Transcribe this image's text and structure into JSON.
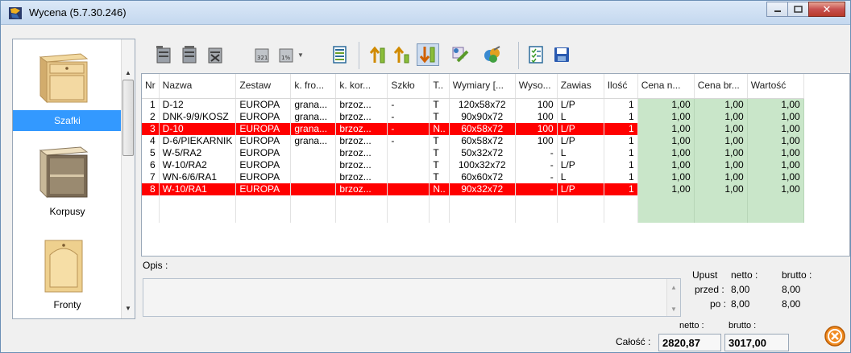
{
  "window": {
    "title": "Wycena (5.7.30.246)"
  },
  "sidebar": {
    "categories": [
      {
        "label": "Szafki",
        "icon": "cabinet-icon",
        "selected": true
      },
      {
        "label": "Korpusy",
        "icon": "carcass-icon",
        "selected": false
      },
      {
        "label": "Fronty",
        "icon": "front-door-icon",
        "selected": false
      }
    ]
  },
  "table": {
    "columns": [
      "Nr",
      "Nazwa",
      "Zestaw",
      "k. fro...",
      "k. kor...",
      "Szkło",
      "T..",
      "Wymiary [...",
      "Wyso...",
      "Zawias",
      "Ilość",
      "Cena n...",
      "Cena br...",
      "Wartość"
    ],
    "rows": [
      {
        "nr": "1",
        "nazwa": "D-12",
        "zestaw": "EUROPA",
        "kfro": "grana...",
        "kkor": "brzoz...",
        "szklo": "-",
        "t": "T",
        "wym": "120x58x72",
        "wys": "100",
        "zaw": "L/P",
        "ilosc": "1",
        "cn": "1,00",
        "cb": "1,00",
        "wart": "1,00",
        "highlight": false
      },
      {
        "nr": "2",
        "nazwa": "DNK-9/9/KOSZ",
        "zestaw": "EUROPA",
        "kfro": "grana...",
        "kkor": "brzoz...",
        "szklo": "-",
        "t": "T",
        "wym": "90x90x72",
        "wys": "100",
        "zaw": "L",
        "ilosc": "1",
        "cn": "1,00",
        "cb": "1,00",
        "wart": "1,00",
        "highlight": false
      },
      {
        "nr": "3",
        "nazwa": "D-10",
        "zestaw": "EUROPA",
        "kfro": "grana...",
        "kkor": "brzoz...",
        "szklo": "-",
        "t": "N..",
        "wym": "60x58x72",
        "wys": "100",
        "zaw": "L/P",
        "ilosc": "1",
        "cn": "1,00",
        "cb": "1,00",
        "wart": "1,00",
        "highlight": true
      },
      {
        "nr": "4",
        "nazwa": "D-6/PIEKARNIK",
        "zestaw": "EUROPA",
        "kfro": "grana...",
        "kkor": "brzoz...",
        "szklo": "-",
        "t": "T",
        "wym": "60x58x72",
        "wys": "100",
        "zaw": "L/P",
        "ilosc": "1",
        "cn": "1,00",
        "cb": "1,00",
        "wart": "1,00",
        "highlight": false
      },
      {
        "nr": "5",
        "nazwa": "W-5/RA2",
        "zestaw": "EUROPA",
        "kfro": "",
        "kkor": "brzoz...",
        "szklo": "",
        "t": "T",
        "wym": "50x32x72",
        "wys": "-",
        "zaw": "L",
        "ilosc": "1",
        "cn": "1,00",
        "cb": "1,00",
        "wart": "1,00",
        "highlight": false
      },
      {
        "nr": "6",
        "nazwa": "W-10/RA2",
        "zestaw": "EUROPA",
        "kfro": "",
        "kkor": "brzoz...",
        "szklo": "",
        "t": "T",
        "wym": "100x32x72",
        "wys": "-",
        "zaw": "L/P",
        "ilosc": "1",
        "cn": "1,00",
        "cb": "1,00",
        "wart": "1,00",
        "highlight": false
      },
      {
        "nr": "7",
        "nazwa": "WN-6/6/RA1",
        "zestaw": "EUROPA",
        "kfro": "",
        "kkor": "brzoz...",
        "szklo": "",
        "t": "T",
        "wym": "60x60x72",
        "wys": "-",
        "zaw": "L",
        "ilosc": "1",
        "cn": "1,00",
        "cb": "1,00",
        "wart": "1,00",
        "highlight": false
      },
      {
        "nr": "8",
        "nazwa": "W-10/RA1",
        "zestaw": "EUROPA",
        "kfro": "",
        "kkor": "brzoz...",
        "szklo": "",
        "t": "N..",
        "wym": "90x32x72",
        "wys": "-",
        "zaw": "L/P",
        "ilosc": "1",
        "cn": "1,00",
        "cb": "1,00",
        "wart": "1,00",
        "highlight": true
      }
    ]
  },
  "opis": {
    "label": "Opis :"
  },
  "discount": {
    "upust_label": "Upust",
    "netto_label": "netto :",
    "brutto_label": "brutto :",
    "przed_label": "przed :",
    "przed_netto": "8,00",
    "przed_brutto": "8,00",
    "po_label": "po :",
    "po_netto": "8,00",
    "po_brutto": "8,00"
  },
  "totals": {
    "label": "Całość :",
    "netto_label": "netto :",
    "brutto_label": "brutto :",
    "netto": "2820,87",
    "brutto": "3017,00"
  },
  "colors": {
    "highlight": "#ff0000",
    "price_cell": "#c9e6c9",
    "selected": "#3399ff"
  }
}
